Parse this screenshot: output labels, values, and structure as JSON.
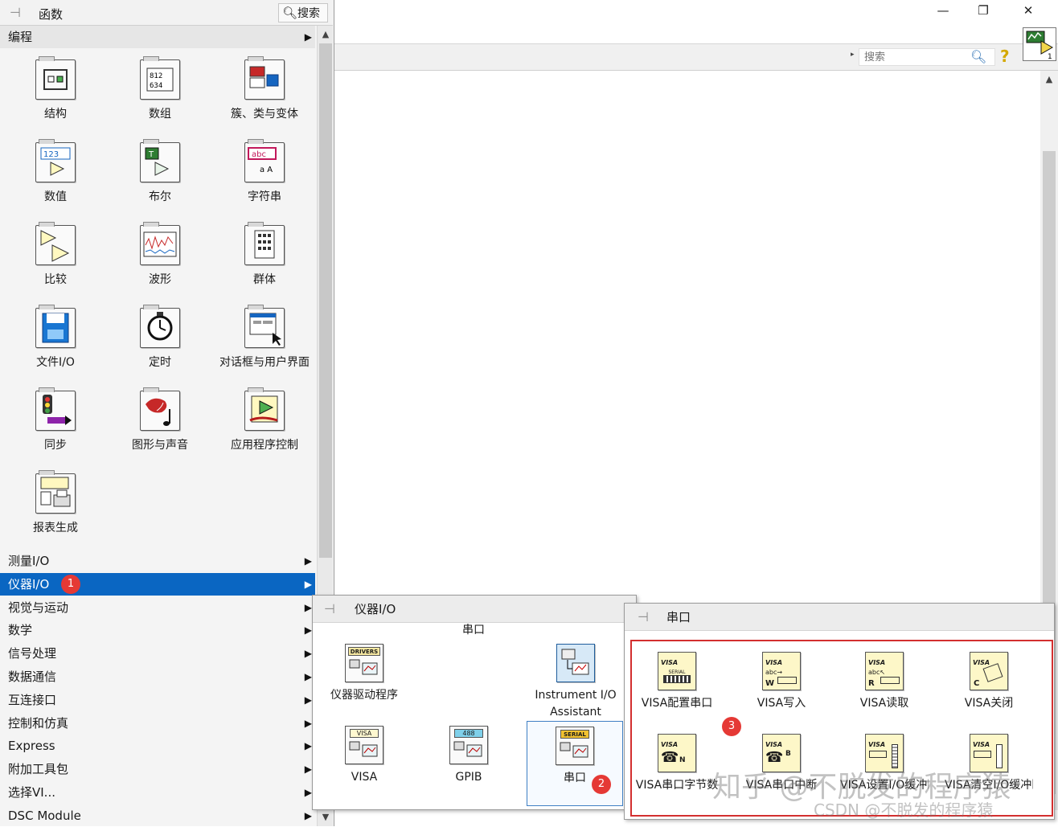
{
  "window": {
    "controls": {
      "minimize": "—",
      "maximize": "❐",
      "close": "✕"
    },
    "search_placeholder": "搜索",
    "help_icon": "question-icon"
  },
  "palette": {
    "title": "函数",
    "search_button": "搜索",
    "header_category": "编程",
    "programming_items": [
      {
        "label": "结构",
        "icon": "structures-icon"
      },
      {
        "label": "数组",
        "icon": "array-icon"
      },
      {
        "label": "簇、类与变体",
        "icon": "cluster-icon"
      },
      {
        "label": "数值",
        "icon": "numeric-icon"
      },
      {
        "label": "布尔",
        "icon": "boolean-icon"
      },
      {
        "label": "字符串",
        "icon": "string-icon"
      },
      {
        "label": "比较",
        "icon": "comparison-icon"
      },
      {
        "label": "波形",
        "icon": "waveform-icon"
      },
      {
        "label": "群体",
        "icon": "cluster-group-icon"
      },
      {
        "label": "文件I/O",
        "icon": "file-io-icon"
      },
      {
        "label": "定时",
        "icon": "timing-icon"
      },
      {
        "label": "对话框与用户界面",
        "icon": "dialog-icon"
      },
      {
        "label": "同步",
        "icon": "sync-icon"
      },
      {
        "label": "图形与声音",
        "icon": "graphics-sound-icon"
      },
      {
        "label": "应用程序控制",
        "icon": "app-control-icon"
      },
      {
        "label": "报表生成",
        "icon": "report-icon"
      }
    ],
    "categories": [
      {
        "label": "测量I/O"
      },
      {
        "label": "仪器I/O",
        "selected": true
      },
      {
        "label": "视觉与运动"
      },
      {
        "label": "数学"
      },
      {
        "label": "信号处理"
      },
      {
        "label": "数据通信"
      },
      {
        "label": "互连接口"
      },
      {
        "label": "控制和仿真"
      },
      {
        "label": "Express"
      },
      {
        "label": "附加工具包"
      },
      {
        "label": "选择VI..."
      },
      {
        "label": "DSC Module"
      }
    ]
  },
  "instrument_io": {
    "title": "仪器I/O",
    "section_label": "串口",
    "items": [
      {
        "label": "仪器驱动程序",
        "icon": "drivers-icon",
        "icon_text": "DRIVERS"
      },
      {
        "label": "Instrument I/O",
        "label2": "Assistant",
        "icon": "assistant-icon"
      },
      {
        "label": "VISA",
        "icon": "visa-icon",
        "icon_text": "VISA"
      },
      {
        "label": "GPIB",
        "icon": "gpib-icon",
        "icon_text": "488"
      },
      {
        "label": "串口",
        "icon": "serial-icon",
        "icon_text": "SERIAL"
      }
    ]
  },
  "serial": {
    "title": "串口",
    "items": [
      {
        "label": "VISA配置串口",
        "icon_text": "VISA"
      },
      {
        "label": "VISA写入",
        "icon_text": "VISA"
      },
      {
        "label": "VISA读取",
        "icon_text": "VISA"
      },
      {
        "label": "VISA关闭",
        "icon_text": "VISA"
      },
      {
        "label": "VISA串口字节数",
        "icon_text": "VISA"
      },
      {
        "label": "VISA串口中断",
        "icon_text": "VISA"
      },
      {
        "label": "VISA设置I/O缓冲区",
        "icon_text": "VISA"
      },
      {
        "label": "VISA清空I/O缓冲区",
        "icon_text": "VISA"
      }
    ]
  },
  "badges": {
    "b1": "1",
    "b2": "2",
    "b3": "3"
  },
  "watermark": {
    "line1": "知乎 @不脱发的程序猿",
    "line2": "CSDN @不脱发的程序猿"
  },
  "colors": {
    "selection": "#0a66c2",
    "badge": "#e53935",
    "frame": "#d32f2f"
  }
}
